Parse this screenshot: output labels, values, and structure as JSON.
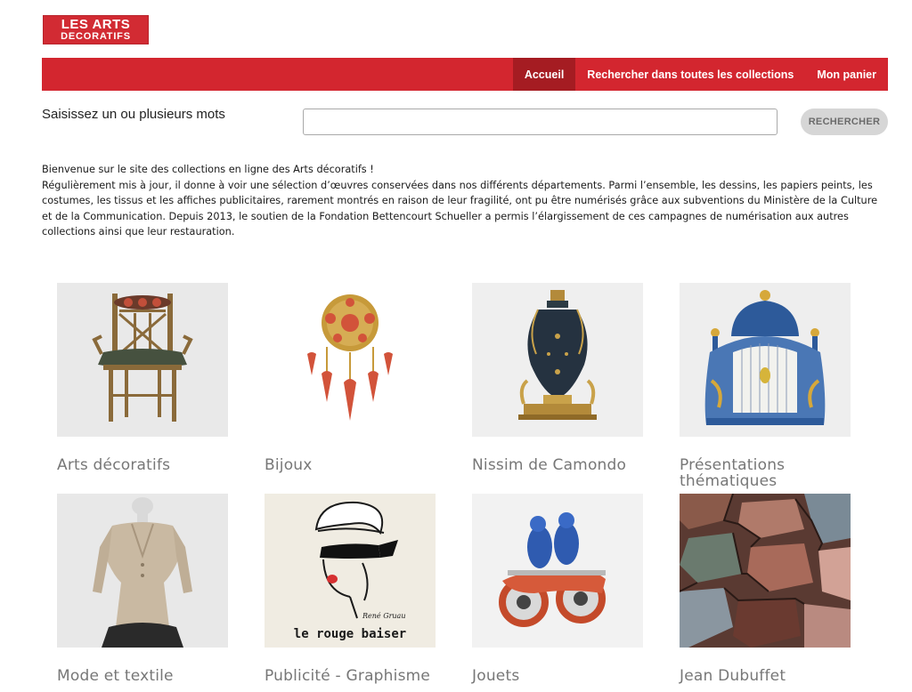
{
  "logo": {
    "line1": "LES ARTS",
    "line2": "DECORATIFS"
  },
  "nav": {
    "items": [
      {
        "label": "Accueil",
        "active": true
      },
      {
        "label": "Rechercher dans toutes les collections",
        "active": false
      },
      {
        "label": "Mon panier",
        "active": false
      }
    ]
  },
  "search": {
    "label": "Saisissez un ou plusieurs mots",
    "value": "",
    "placeholder": "",
    "button_label": "RECHERCHER"
  },
  "intro": {
    "line1": "Bienvenue sur le site des collections en ligne des Arts décoratifs !",
    "line2": "Régulièrement mis à jour, il donne à voir une sélection d’œuvres conservées dans nos différents départements. Parmi l’ensemble, les dessins, les papiers peints, les costumes, les tissus et les affiches publicitaires, rarement montrés en raison de leur fragilité, ont pu être numérisés grâce aux subventions du Ministère de la Culture et de la Communication. Depuis 2013, le soutien de la Fondation Bettencourt Schueller a permis l’élargissement de ces campagnes de numérisation aux autres collections ainsi que leur restauration."
  },
  "collections": [
    {
      "title": "Arts décoratifs",
      "image": "chair"
    },
    {
      "title": "Bijoux",
      "image": "coral-brooch"
    },
    {
      "title": "Nissim de Camondo",
      "image": "vase"
    },
    {
      "title": "Présentations thématiques",
      "image": "birdcage-clock"
    },
    {
      "title": "Mode et textile",
      "image": "jacket"
    },
    {
      "title": "Publicité - Graphisme",
      "image": "rouge-baiser-poster"
    },
    {
      "title": "Jouets",
      "image": "tin-motorcycle"
    },
    {
      "title": "Jean Dubuffet",
      "image": "abstract-painting"
    }
  ],
  "poster": {
    "line1": "le rouge baiser",
    "signature": "René Gruau"
  },
  "colors": {
    "brand_red": "#d3262f",
    "nav_active": "#a51c22",
    "card_title": "#777777",
    "button_bg": "#d6d6d6"
  }
}
